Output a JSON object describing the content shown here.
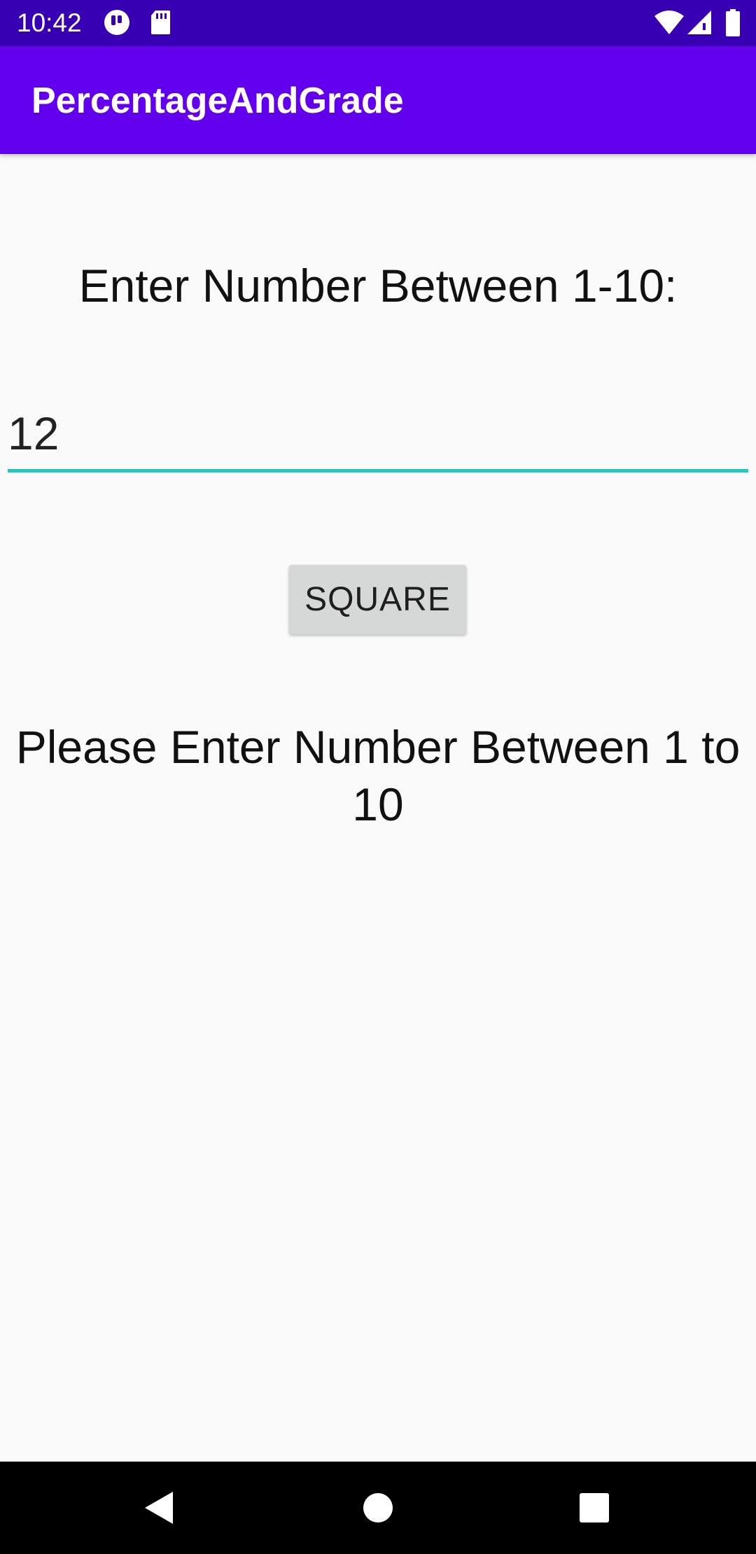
{
  "status_bar": {
    "time": "10:42",
    "left_icons": [
      "notification-app-icon",
      "sd-card-icon"
    ],
    "right_icons": [
      "wifi-icon",
      "cellular-signal-icon",
      "battery-icon"
    ]
  },
  "app_bar": {
    "title": "PercentageAndGrade"
  },
  "main": {
    "prompt": "Enter Number Between 1-10:",
    "number_input_value": "12",
    "square_button_label": "SQUARE",
    "message": "Please Enter Number Between 1 to 10"
  },
  "nav_bar": {
    "buttons": [
      "back-icon",
      "home-icon",
      "recents-icon"
    ]
  },
  "colors": {
    "status_bar": "#3700b3",
    "app_bar": "#6200ee",
    "input_underline": "#26c6c0",
    "button_bg": "#d6d7d7",
    "background": "#fafafa"
  }
}
